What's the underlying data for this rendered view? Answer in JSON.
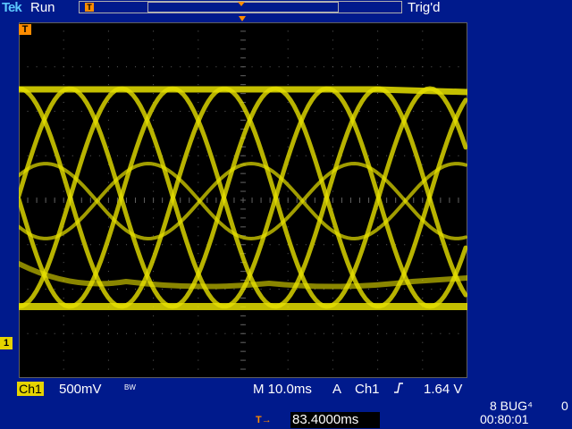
{
  "header": {
    "brand": "Tek",
    "acquisition_state": "Run",
    "trigger_status": "Trig'd"
  },
  "record_bar": {
    "trigger_marker": "T"
  },
  "screen": {
    "trigger_marker": "T",
    "channel_marker": "1",
    "trace_color": "#e6e000",
    "graticule_color": "#606060"
  },
  "readouts": {
    "channel_label": "Ch1",
    "volts_per_div": "500mV",
    "bandwidth_limit": "BW",
    "timebase": "M 10.0ms",
    "trigger_mode": "A",
    "trigger_source": "Ch1",
    "trigger_slope_icon": "rising-edge-icon",
    "trigger_level": "1.64 V"
  },
  "footer": {
    "trigger_position_label": "T→",
    "trigger_position_value": "83.4000ms",
    "status_line": "8 BUG⁴",
    "status_value": "0",
    "clock": "00:80:01"
  }
}
